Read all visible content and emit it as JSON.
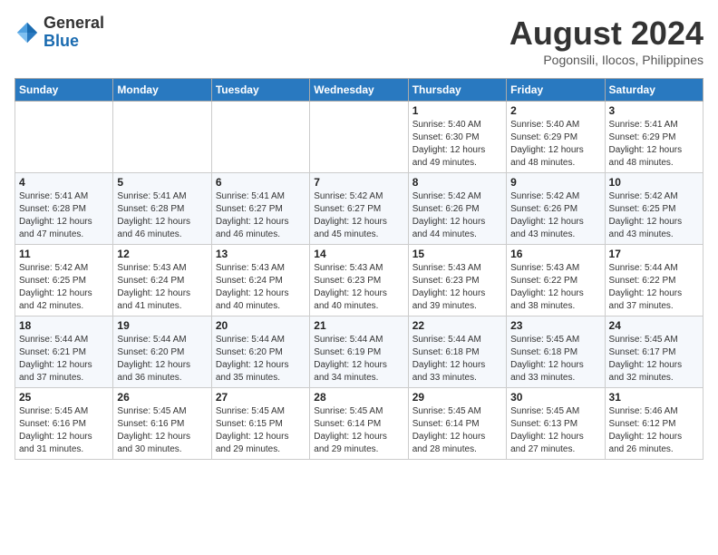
{
  "header": {
    "logo_general": "General",
    "logo_blue": "Blue",
    "month_year": "August 2024",
    "location": "Pogonsili, Ilocos, Philippines"
  },
  "days_of_week": [
    "Sunday",
    "Monday",
    "Tuesday",
    "Wednesday",
    "Thursday",
    "Friday",
    "Saturday"
  ],
  "weeks": [
    [
      {
        "day": "",
        "info": ""
      },
      {
        "day": "",
        "info": ""
      },
      {
        "day": "",
        "info": ""
      },
      {
        "day": "",
        "info": ""
      },
      {
        "day": "1",
        "info": "Sunrise: 5:40 AM\nSunset: 6:30 PM\nDaylight: 12 hours\nand 49 minutes."
      },
      {
        "day": "2",
        "info": "Sunrise: 5:40 AM\nSunset: 6:29 PM\nDaylight: 12 hours\nand 48 minutes."
      },
      {
        "day": "3",
        "info": "Sunrise: 5:41 AM\nSunset: 6:29 PM\nDaylight: 12 hours\nand 48 minutes."
      }
    ],
    [
      {
        "day": "4",
        "info": "Sunrise: 5:41 AM\nSunset: 6:28 PM\nDaylight: 12 hours\nand 47 minutes."
      },
      {
        "day": "5",
        "info": "Sunrise: 5:41 AM\nSunset: 6:28 PM\nDaylight: 12 hours\nand 46 minutes."
      },
      {
        "day": "6",
        "info": "Sunrise: 5:41 AM\nSunset: 6:27 PM\nDaylight: 12 hours\nand 46 minutes."
      },
      {
        "day": "7",
        "info": "Sunrise: 5:42 AM\nSunset: 6:27 PM\nDaylight: 12 hours\nand 45 minutes."
      },
      {
        "day": "8",
        "info": "Sunrise: 5:42 AM\nSunset: 6:26 PM\nDaylight: 12 hours\nand 44 minutes."
      },
      {
        "day": "9",
        "info": "Sunrise: 5:42 AM\nSunset: 6:26 PM\nDaylight: 12 hours\nand 43 minutes."
      },
      {
        "day": "10",
        "info": "Sunrise: 5:42 AM\nSunset: 6:25 PM\nDaylight: 12 hours\nand 43 minutes."
      }
    ],
    [
      {
        "day": "11",
        "info": "Sunrise: 5:42 AM\nSunset: 6:25 PM\nDaylight: 12 hours\nand 42 minutes."
      },
      {
        "day": "12",
        "info": "Sunrise: 5:43 AM\nSunset: 6:24 PM\nDaylight: 12 hours\nand 41 minutes."
      },
      {
        "day": "13",
        "info": "Sunrise: 5:43 AM\nSunset: 6:24 PM\nDaylight: 12 hours\nand 40 minutes."
      },
      {
        "day": "14",
        "info": "Sunrise: 5:43 AM\nSunset: 6:23 PM\nDaylight: 12 hours\nand 40 minutes."
      },
      {
        "day": "15",
        "info": "Sunrise: 5:43 AM\nSunset: 6:23 PM\nDaylight: 12 hours\nand 39 minutes."
      },
      {
        "day": "16",
        "info": "Sunrise: 5:43 AM\nSunset: 6:22 PM\nDaylight: 12 hours\nand 38 minutes."
      },
      {
        "day": "17",
        "info": "Sunrise: 5:44 AM\nSunset: 6:22 PM\nDaylight: 12 hours\nand 37 minutes."
      }
    ],
    [
      {
        "day": "18",
        "info": "Sunrise: 5:44 AM\nSunset: 6:21 PM\nDaylight: 12 hours\nand 37 minutes."
      },
      {
        "day": "19",
        "info": "Sunrise: 5:44 AM\nSunset: 6:20 PM\nDaylight: 12 hours\nand 36 minutes."
      },
      {
        "day": "20",
        "info": "Sunrise: 5:44 AM\nSunset: 6:20 PM\nDaylight: 12 hours\nand 35 minutes."
      },
      {
        "day": "21",
        "info": "Sunrise: 5:44 AM\nSunset: 6:19 PM\nDaylight: 12 hours\nand 34 minutes."
      },
      {
        "day": "22",
        "info": "Sunrise: 5:44 AM\nSunset: 6:18 PM\nDaylight: 12 hours\nand 33 minutes."
      },
      {
        "day": "23",
        "info": "Sunrise: 5:45 AM\nSunset: 6:18 PM\nDaylight: 12 hours\nand 33 minutes."
      },
      {
        "day": "24",
        "info": "Sunrise: 5:45 AM\nSunset: 6:17 PM\nDaylight: 12 hours\nand 32 minutes."
      }
    ],
    [
      {
        "day": "25",
        "info": "Sunrise: 5:45 AM\nSunset: 6:16 PM\nDaylight: 12 hours\nand 31 minutes."
      },
      {
        "day": "26",
        "info": "Sunrise: 5:45 AM\nSunset: 6:16 PM\nDaylight: 12 hours\nand 30 minutes."
      },
      {
        "day": "27",
        "info": "Sunrise: 5:45 AM\nSunset: 6:15 PM\nDaylight: 12 hours\nand 29 minutes."
      },
      {
        "day": "28",
        "info": "Sunrise: 5:45 AM\nSunset: 6:14 PM\nDaylight: 12 hours\nand 29 minutes."
      },
      {
        "day": "29",
        "info": "Sunrise: 5:45 AM\nSunset: 6:14 PM\nDaylight: 12 hours\nand 28 minutes."
      },
      {
        "day": "30",
        "info": "Sunrise: 5:45 AM\nSunset: 6:13 PM\nDaylight: 12 hours\nand 27 minutes."
      },
      {
        "day": "31",
        "info": "Sunrise: 5:46 AM\nSunset: 6:12 PM\nDaylight: 12 hours\nand 26 minutes."
      }
    ]
  ]
}
